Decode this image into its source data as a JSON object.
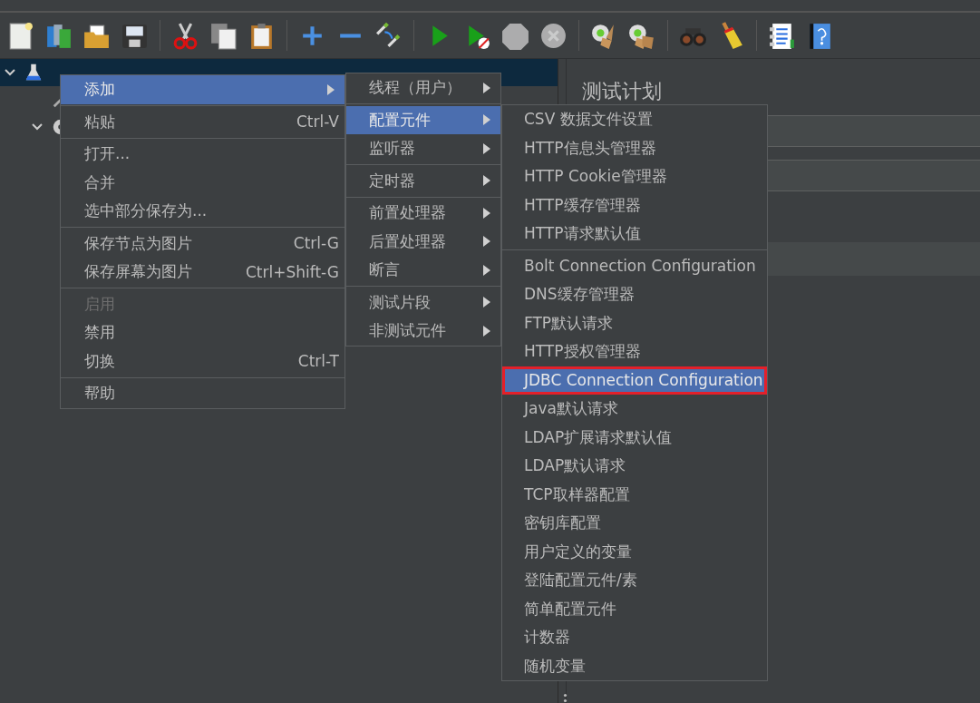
{
  "toolbar": [
    [
      {
        "kind": "new",
        "disabled": false
      },
      {
        "kind": "templates",
        "disabled": false
      },
      {
        "kind": "open",
        "disabled": false
      },
      {
        "kind": "save",
        "disabled": false
      }
    ],
    [
      {
        "kind": "cut",
        "disabled": false
      },
      {
        "kind": "copy",
        "disabled": false
      },
      {
        "kind": "paste",
        "disabled": false
      }
    ],
    [
      {
        "kind": "expand",
        "disabled": false
      },
      {
        "kind": "collapse",
        "disabled": false
      },
      {
        "kind": "toggle",
        "disabled": false
      }
    ],
    [
      {
        "kind": "start",
        "disabled": false
      },
      {
        "kind": "start-no-timers",
        "disabled": false
      },
      {
        "kind": "stop",
        "disabled": true
      },
      {
        "kind": "shutdown",
        "disabled": true
      }
    ],
    [
      {
        "kind": "clear",
        "disabled": false
      },
      {
        "kind": "clear-all",
        "disabled": false
      }
    ],
    [
      {
        "kind": "search",
        "disabled": false
      },
      {
        "kind": "reset-search",
        "disabled": false
      }
    ],
    [
      {
        "kind": "functions",
        "disabled": false
      },
      {
        "kind": "help",
        "disabled": false
      }
    ]
  ],
  "tree": {
    "items": [
      {
        "kind": "plan",
        "selected": true,
        "expanded": true,
        "children": [
          {
            "kind": "tool",
            "selected": false
          },
          {
            "kind": "gear",
            "selected": false,
            "expanded": true
          }
        ]
      }
    ]
  },
  "panel": {
    "title": "测试计划"
  },
  "menus": [
    {
      "items": [
        {
          "kind": "item",
          "label": "添加",
          "submenu": true,
          "selected": true,
          "disabled": false
        },
        {
          "kind": "separator"
        },
        {
          "kind": "item",
          "label": "粘贴",
          "shortcut": "Ctrl-V",
          "submenu": false,
          "selected": false,
          "disabled": false
        },
        {
          "kind": "separator"
        },
        {
          "kind": "item",
          "label": "打开...",
          "submenu": false,
          "selected": false,
          "disabled": false
        },
        {
          "kind": "item",
          "label": "合并",
          "submenu": false,
          "selected": false,
          "disabled": false
        },
        {
          "kind": "item",
          "label": "选中部分保存为...",
          "submenu": false,
          "selected": false,
          "disabled": false
        },
        {
          "kind": "separator"
        },
        {
          "kind": "item",
          "label": "保存节点为图片",
          "shortcut": "Ctrl-G",
          "submenu": false,
          "selected": false,
          "disabled": false
        },
        {
          "kind": "item",
          "label": "保存屏幕为图片",
          "shortcut": "Ctrl+Shift-G",
          "submenu": false,
          "selected": false,
          "disabled": false
        },
        {
          "kind": "separator"
        },
        {
          "kind": "item",
          "label": "启用",
          "submenu": false,
          "selected": false,
          "disabled": true
        },
        {
          "kind": "item",
          "label": "禁用",
          "submenu": false,
          "selected": false,
          "disabled": false
        },
        {
          "kind": "item",
          "label": "切换",
          "shortcut": "Ctrl-T",
          "submenu": false,
          "selected": false,
          "disabled": false
        },
        {
          "kind": "separator"
        },
        {
          "kind": "item",
          "label": "帮助",
          "submenu": false,
          "selected": false,
          "disabled": false
        }
      ]
    },
    {
      "items": [
        {
          "kind": "item",
          "label": "线程（用户）",
          "submenu": true,
          "selected": false
        },
        {
          "kind": "separator"
        },
        {
          "kind": "item",
          "label": "配置元件",
          "submenu": true,
          "selected": true
        },
        {
          "kind": "item",
          "label": "监听器",
          "submenu": true,
          "selected": false
        },
        {
          "kind": "separator"
        },
        {
          "kind": "item",
          "label": "定时器",
          "submenu": true,
          "selected": false
        },
        {
          "kind": "separator"
        },
        {
          "kind": "item",
          "label": "前置处理器",
          "submenu": true,
          "selected": false
        },
        {
          "kind": "item",
          "label": "后置处理器",
          "submenu": true,
          "selected": false
        },
        {
          "kind": "item",
          "label": "断言",
          "submenu": true,
          "selected": false
        },
        {
          "kind": "separator"
        },
        {
          "kind": "item",
          "label": "测试片段",
          "submenu": true,
          "selected": false
        },
        {
          "kind": "item",
          "label": "非测试元件",
          "submenu": true,
          "selected": false
        }
      ]
    },
    {
      "items": [
        {
          "kind": "item",
          "label": "CSV 数据文件设置",
          "selected": false
        },
        {
          "kind": "item",
          "label": "HTTP信息头管理器",
          "selected": false
        },
        {
          "kind": "item",
          "label": "HTTP Cookie管理器",
          "selected": false
        },
        {
          "kind": "item",
          "label": "HTTP缓存管理器",
          "selected": false
        },
        {
          "kind": "item",
          "label": "HTTP请求默认值",
          "selected": false
        },
        {
          "kind": "separator"
        },
        {
          "kind": "item",
          "label": "Bolt Connection Configuration",
          "selected": false
        },
        {
          "kind": "item",
          "label": "DNS缓存管理器",
          "selected": false
        },
        {
          "kind": "item",
          "label": "FTP默认请求",
          "selected": false
        },
        {
          "kind": "item",
          "label": "HTTP授权管理器",
          "selected": false
        },
        {
          "kind": "item",
          "label": "JDBC Connection Configuration",
          "selected": true,
          "highlighted": true
        },
        {
          "kind": "item",
          "label": "Java默认请求",
          "selected": false
        },
        {
          "kind": "item",
          "label": "LDAP扩展请求默认值",
          "selected": false
        },
        {
          "kind": "item",
          "label": "LDAP默认请求",
          "selected": false
        },
        {
          "kind": "item",
          "label": "TCP取样器配置",
          "selected": false
        },
        {
          "kind": "item",
          "label": "密钥库配置",
          "selected": false
        },
        {
          "kind": "item",
          "label": "用户定义的变量",
          "selected": false
        },
        {
          "kind": "item",
          "label": "登陆配置元件/素",
          "selected": false
        },
        {
          "kind": "item",
          "label": "简单配置元件",
          "selected": false
        },
        {
          "kind": "item",
          "label": "计数器",
          "selected": false
        },
        {
          "kind": "item",
          "label": "随机变量",
          "selected": false
        }
      ]
    }
  ]
}
